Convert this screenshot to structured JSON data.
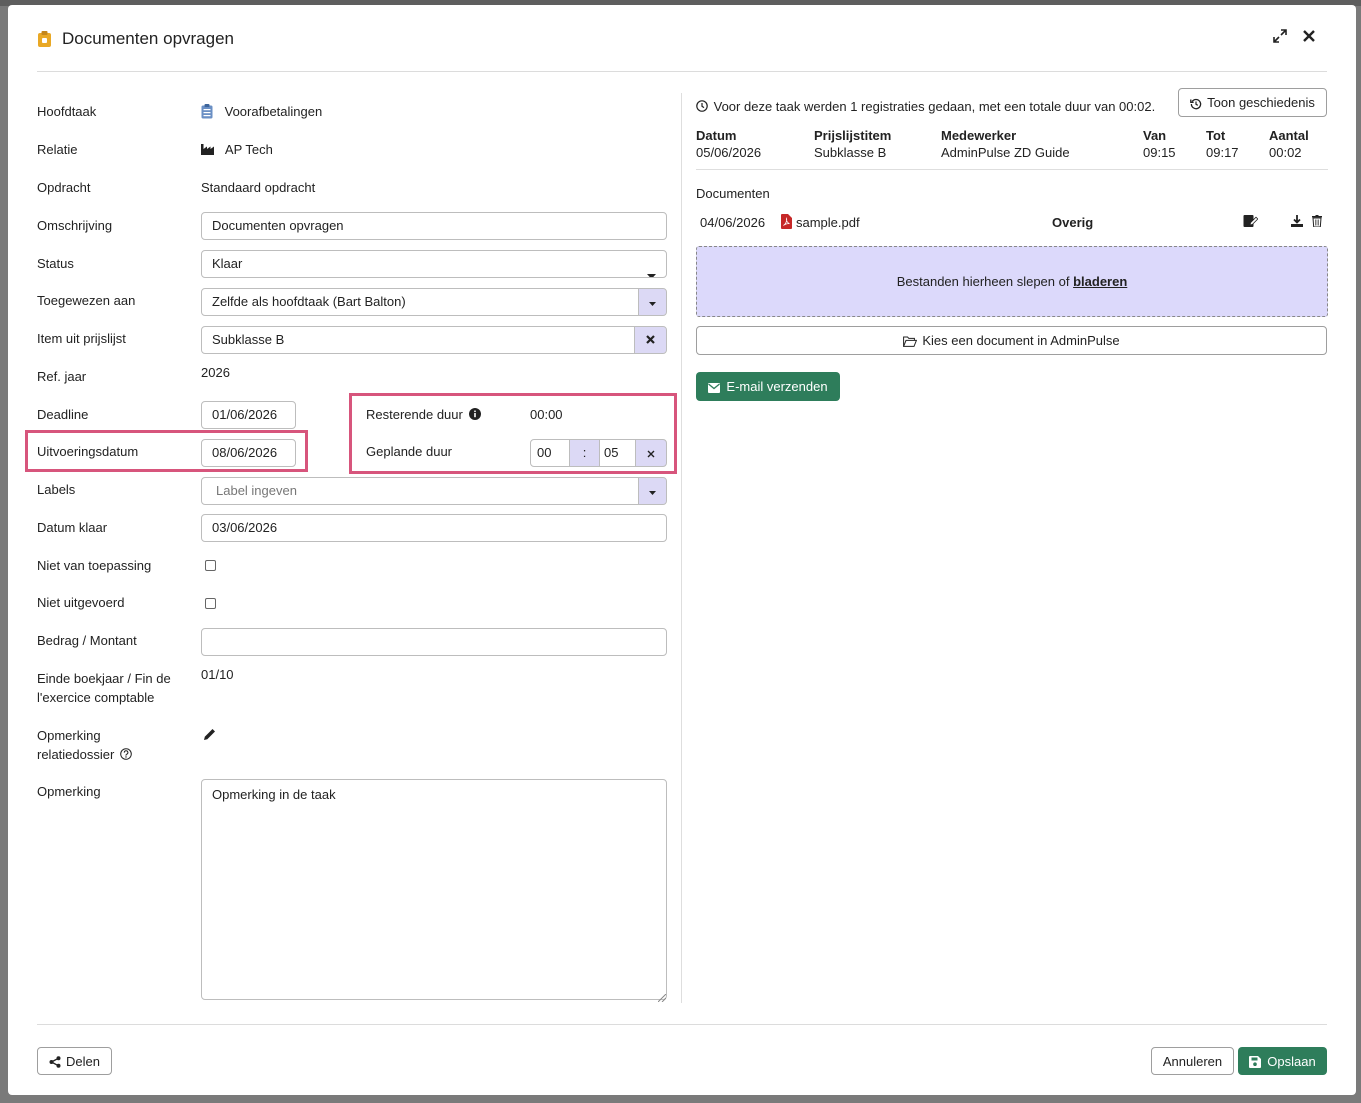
{
  "modal": {
    "title": "Documenten opvragen"
  },
  "form": {
    "hoofdtaak": {
      "label": "Hoofdtaak",
      "value": "Voorafbetalingen"
    },
    "relatie": {
      "label": "Relatie",
      "value": "AP Tech"
    },
    "opdracht": {
      "label": "Opdracht",
      "value": "Standaard opdracht"
    },
    "omschrijving": {
      "label": "Omschrijving",
      "value": "Documenten opvragen"
    },
    "status": {
      "label": "Status",
      "value": "Klaar"
    },
    "toegewezen": {
      "label": "Toegewezen aan",
      "value": "Zelfde als hoofdtaak (Bart Balton)"
    },
    "item_prijslijst": {
      "label": "Item uit prijslijst",
      "value": "Subklasse B"
    },
    "ref_jaar": {
      "label": "Ref. jaar",
      "value": "2026"
    },
    "deadline": {
      "label": "Deadline",
      "value": "01/06/2026"
    },
    "uitvoeringsdatum": {
      "label": "Uitvoeringsdatum",
      "value": "08/06/2026"
    },
    "resterende_duur": {
      "label": "Resterende duur",
      "value": "00:00"
    },
    "geplande_duur": {
      "label": "Geplande duur",
      "hours": "00",
      "separator": ":",
      "minutes": "05"
    },
    "labels": {
      "label": "Labels",
      "placeholder": "Label ingeven"
    },
    "datum_klaar": {
      "label": "Datum klaar",
      "value": "03/06/2026"
    },
    "niet_van_toepassing": {
      "label": "Niet van toepassing"
    },
    "niet_uitgevoerd": {
      "label": "Niet uitgevoerd"
    },
    "bedrag": {
      "label": "Bedrag / Montant",
      "value": ""
    },
    "einde_boekjaar": {
      "label_line1": "Einde boekjaar / Fin de",
      "label_line2": "l'exercice comptable",
      "value": "01/10"
    },
    "opmerking_relatiedossier": {
      "label_line1": "Opmerking",
      "label_line2": "relatiedossier"
    },
    "opmerking": {
      "label": "Opmerking",
      "value": "Opmerking in de taak"
    }
  },
  "registrations": {
    "summary": "Voor deze taak werden 1 registraties gedaan, met een totale duur van 00:02.",
    "history_button": "Toon geschiedenis",
    "headers": [
      "Datum",
      "Prijslijstitem",
      "Medewerker",
      "Van",
      "Tot",
      "Aantal"
    ],
    "rows": [
      [
        "05/06/2026",
        "Subklasse B",
        "AdminPulse ZD Guide",
        "09:15",
        "09:17",
        "00:02"
      ]
    ]
  },
  "documents": {
    "title": "Documenten",
    "items": [
      {
        "date": "04/06/2026",
        "filename": "sample.pdf",
        "category": "Overig"
      }
    ],
    "dropzone_text": "Bestanden hierheen slepen of",
    "dropzone_link": "bladeren",
    "choose_button": "Kies een document in AdminPulse",
    "email_button": "E-mail verzenden"
  },
  "footer": {
    "share_button": "Delen",
    "cancel_button": "Annuleren",
    "save_button": "Opslaan"
  },
  "colors": {
    "accent_green": "#2e7d5b",
    "highlight": "#d7557c",
    "addon": "#dcd9f5",
    "dropzone": "#dcd9fb"
  }
}
